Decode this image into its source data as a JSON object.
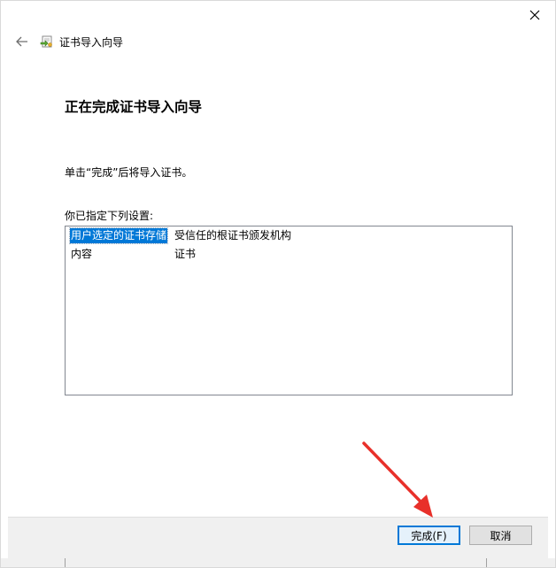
{
  "window": {
    "title": "证书导入向导",
    "close_icon": "close-icon",
    "back_icon": "back-arrow-icon",
    "app_icon": "certificate-import-icon"
  },
  "main": {
    "heading": "正在完成证书导入向导",
    "instruction": "单击“完成”后将导入证书。",
    "list_label": "你已指定下列设置:",
    "settings": [
      {
        "key": "用户选定的证书存储",
        "value": "受信任的根证书颁发机构",
        "selected": true
      },
      {
        "key": "内容",
        "value": "证书",
        "selected": false
      }
    ]
  },
  "footer": {
    "finish_label": "完成(F)",
    "cancel_label": "取消"
  },
  "colors": {
    "accent": "#0078d7",
    "annotation_arrow": "#e8302a"
  }
}
